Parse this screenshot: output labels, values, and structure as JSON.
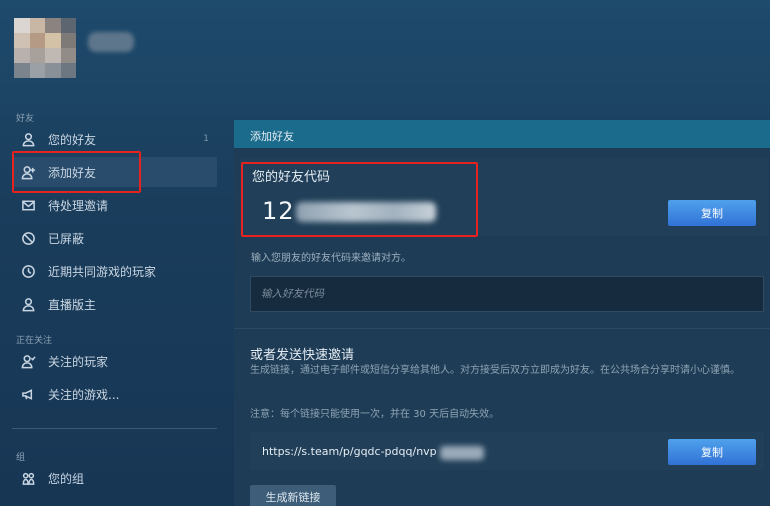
{
  "sidebar": {
    "friends_section": "好友",
    "items": [
      {
        "label": "您的好友",
        "count": "1"
      },
      {
        "label": "添加好友"
      },
      {
        "label": "待处理邀请"
      },
      {
        "label": "已屏蔽"
      },
      {
        "label": "近期共同游戏的玩家"
      },
      {
        "label": "直播版主"
      }
    ],
    "following_section": "正在关注",
    "following_items": [
      {
        "label": "关注的玩家"
      },
      {
        "label": "关注的游戏..."
      }
    ],
    "groups_section": "组",
    "group_items": [
      {
        "label": "您的组"
      }
    ]
  },
  "main": {
    "header_title": "添加好友",
    "friend_code": {
      "title": "您的好友代码",
      "value_visible": "12",
      "copy_label": "复制"
    },
    "hint": "输入您朋友的好友代码来邀请对方。",
    "input_placeholder": "输入好友代码",
    "quick_invite": {
      "title": "或者发送快速邀请",
      "description": "生成链接，通过电子邮件或短信分享给其他人。对方接受后双方立即成为好友。在公共场合分享时请小心谨慎。",
      "note": "注意：每个链接只能使用一次，并在 30 天后自动失效。",
      "link_visible": "https://s.team/p/gqdc-pdqq/nvp",
      "copy_label": "复制",
      "generate_label": "生成新链接"
    }
  },
  "colors": {
    "accent_blue": "#3f8ee3",
    "highlight_red": "#e8231f",
    "header_teal": "#1a6b8c"
  },
  "icons": {
    "friends": "person-icon",
    "add_friend": "person-add-icon",
    "pending": "mail-icon",
    "blocked": "block-icon",
    "recent": "clock-icon",
    "broadcast": "person-icon",
    "followed_players": "person-follow-icon",
    "followed_games": "megaphone-icon",
    "groups": "group-icon"
  }
}
